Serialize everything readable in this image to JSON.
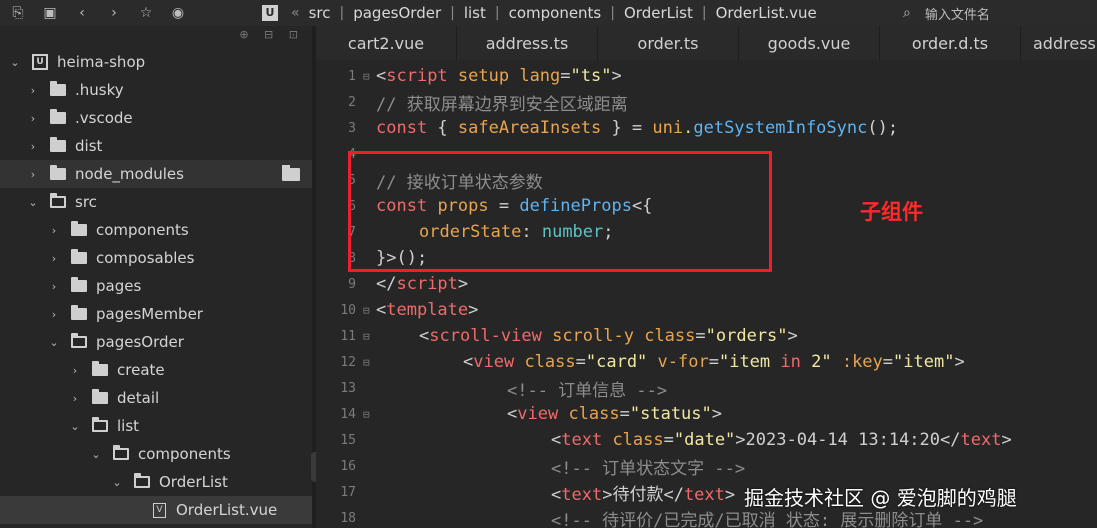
{
  "toolbar": {
    "icons": [
      "explorer-icon",
      "save-icon",
      "back-icon",
      "forward-icon",
      "star-icon",
      "run-icon"
    ]
  },
  "breadcrumb": {
    "logo": "U",
    "items": [
      "src",
      "pagesOrder",
      "list",
      "components",
      "OrderList",
      "OrderList.vue"
    ]
  },
  "file_search": {
    "placeholder": "输入文件名"
  },
  "sidebar": {
    "project": "heima-shop",
    "items": [
      {
        "label": ".husky"
      },
      {
        "label": ".vscode"
      },
      {
        "label": "dist"
      },
      {
        "label": "node_modules"
      },
      {
        "label": "src"
      },
      {
        "label": "components"
      },
      {
        "label": "composables"
      },
      {
        "label": "pages"
      },
      {
        "label": "pagesMember"
      },
      {
        "label": "pagesOrder"
      },
      {
        "label": "create"
      },
      {
        "label": "detail"
      },
      {
        "label": "list"
      },
      {
        "label": "components"
      },
      {
        "label": "OrderList"
      },
      {
        "label": "OrderList.vue"
      }
    ]
  },
  "tabs": [
    "cart2.vue",
    "address.ts",
    "order.ts",
    "goods.vue",
    "order.d.ts",
    "address"
  ],
  "editor": {
    "line_numbers": [
      "1",
      "2",
      "3",
      "4",
      "5",
      "6",
      "7",
      "8",
      "9",
      "10",
      "11",
      "12",
      "13",
      "14",
      "15",
      "16",
      "17",
      "18"
    ],
    "code": {
      "l1_open": "<",
      "l1_tag": "script",
      "l1_attr1": " setup",
      "l1_attr2": " lang",
      "l1_eq": "=",
      "l1_val": "\"ts\"",
      "l1_close": ">",
      "l2": "// 获取屏幕边界到安全区域距离",
      "l3_kw": "const",
      "l3_a": " { ",
      "l3_id": "safeAreaInsets",
      "l3_b": " } = ",
      "l3_obj": "uni",
      "l3_dot": ".",
      "l3_fn": "getSystemInfoSync",
      "l3_end": "();",
      "l4": "// 接收订单状态参数",
      "l5_kw": "const",
      "l5_sp": " ",
      "l5_id": "props",
      "l5_eq": " = ",
      "l5_fn": "defineProps",
      "l5_end": "<{",
      "l6_id": "orderState",
      "l6_colon": ": ",
      "l6_ty": "number",
      "l6_end": ";",
      "l7": "}>();",
      "l8_open": "</",
      "l8_tag": "script",
      "l8_close": ">",
      "l9_open": "<",
      "l9_tag": "template",
      "l9_close": ">",
      "l10_open": "<",
      "l10_tag": "scroll-view",
      "l10_attr1": " scroll-y",
      "l10_attr2": " class",
      "l10_eq": "=",
      "l10_val": "\"orders\"",
      "l10_close": ">",
      "l11_open": "<",
      "l11_tag": "view",
      "l11_attr1": " class",
      "l11_eq": "=",
      "l11_val": "\"card\"",
      "l11_attr2": " v-for",
      "l11_eq2": "=",
      "l11_val2a": "\"item ",
      "l11_in": "in",
      "l11_val2b": " 2\"",
      "l11_attr3": " :key",
      "l11_eq3": "=",
      "l11_val3": "\"item\"",
      "l11_close": ">",
      "l12": "<!-- 订单信息 -->",
      "l13_open": "<",
      "l13_tag": "view",
      "l13_attr": " class",
      "l13_eq": "=",
      "l13_val": "\"status\"",
      "l13_close": ">",
      "l14_open": "<",
      "l14_tag": "text",
      "l14_attr": " class",
      "l14_eq": "=",
      "l14_val": "\"date\"",
      "l14_gt": ">",
      "l14_text": "2023-04-14 13:14:20",
      "l14_close_open": "</",
      "l14_close_tag": "text",
      "l14_close_gt": ">",
      "l15": "<!-- 订单状态文字 -->",
      "l16_open": "<",
      "l16_tag": "text",
      "l16_gt": ">",
      "l16_text": "待付款",
      "l16_close_open": "</",
      "l16_close_tag": "text",
      "l16_close_gt": ">",
      "l17": "<!-- 待评价/已完成/已取消 状态: 展示删除订单 -->"
    }
  },
  "annotation": "子组件",
  "watermark": "掘金技术社区 @ 爱泡脚的鸡腿",
  "colors": {
    "highlight_box": "#ef1e2a",
    "annotation": "#ff2a2a",
    "keyword": "#f06a6a",
    "string": "#f0e7a0",
    "function": "#5fb3f0",
    "comment": "#8d8d8d"
  }
}
